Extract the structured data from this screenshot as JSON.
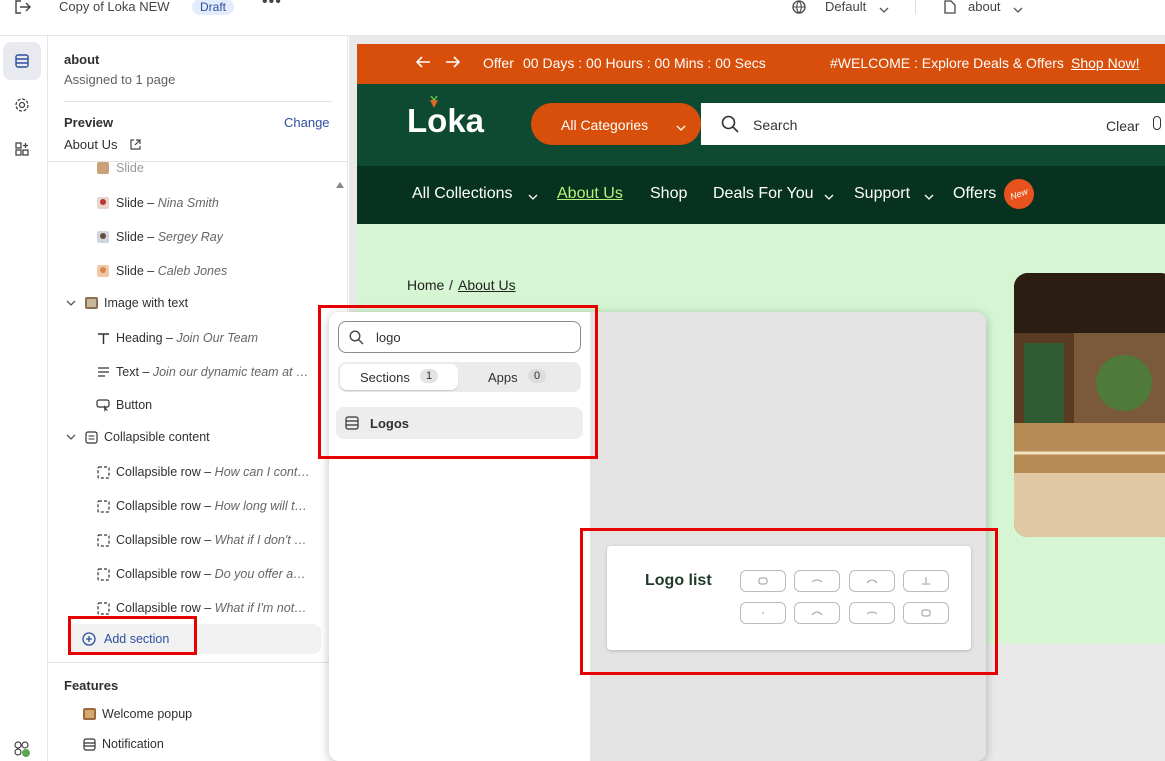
{
  "topbar": {
    "title": "Copy of Loka NEW",
    "status_badge": "Draft",
    "theme_select": "Default",
    "page_select": "about",
    "icons": [
      "exit-icon",
      "more-icon",
      "globe-icon",
      "chevron-down-icon",
      "page-icon"
    ]
  },
  "rail": {
    "icons": [
      "sections-icon",
      "settings-icon",
      "apps-icon",
      "app-store-icon"
    ]
  },
  "panel": {
    "template_name": "about",
    "template_assignment": "Assigned to 1 page",
    "preview_label": "Preview",
    "preview_change": "Change",
    "preview_page": "About Us",
    "tree": [
      {
        "label": "Slide",
        "detail": "Nina Smith",
        "icon": "avatar-icon"
      },
      {
        "label": "Slide",
        "detail": "Sergey Ray",
        "icon": "avatar-icon"
      },
      {
        "label": "Slide",
        "detail": "Caleb Jones",
        "icon": "avatar-icon"
      },
      {
        "label": "Image with text",
        "detail": "",
        "icon": "image-icon"
      },
      {
        "label": "Heading",
        "detail": "Join Our Team",
        "icon": "heading-icon"
      },
      {
        "label": "Text",
        "detail": "Join our dynamic team at …",
        "icon": "text-icon"
      },
      {
        "label": "Button",
        "detail": "",
        "icon": "button-icon"
      },
      {
        "label": "Collapsible content",
        "detail": "",
        "icon": "collapsible-icon"
      },
      {
        "label": "Collapsible row",
        "detail": "How can I cont…",
        "icon": "row-icon"
      },
      {
        "label": "Collapsible row",
        "detail": "How long will t…",
        "icon": "row-icon"
      },
      {
        "label": "Collapsible row",
        "detail": "What if I don't …",
        "icon": "row-icon"
      },
      {
        "label": "Collapsible row",
        "detail": "Do you offer a…",
        "icon": "row-icon"
      },
      {
        "label": "Collapsible row",
        "detail": "What if I'm not…",
        "icon": "row-icon"
      }
    ],
    "add_section": "Add section",
    "features_title": "Features",
    "features": [
      {
        "label": "Welcome popup",
        "icon": "image-icon"
      },
      {
        "label": "Notification",
        "icon": "section-icon"
      }
    ]
  },
  "popover": {
    "search_value": "logo",
    "tabs": [
      {
        "label": "Sections",
        "count": "1"
      },
      {
        "label": "Apps",
        "count": "0"
      }
    ],
    "result": "Logos",
    "preview_title": "Logo list"
  },
  "store": {
    "announce_offer": "Offer",
    "countdown": "00 Days : 00 Hours : 00 Mins : 00 Secs",
    "welcome": "#WELCOME : Explore Deals & Offers",
    "shop_now": "Shop Now!",
    "logo": "Loka",
    "all_categories": "All Categories",
    "search_placeholder": "Search",
    "clear": "Clear",
    "nav": [
      "All Collections",
      "About Us",
      "Shop",
      "Deals For You",
      "Support",
      "Offers"
    ],
    "new_badge": "New",
    "breadcrumb_home": "Home",
    "breadcrumb_sep": "/",
    "breadcrumb_current": "About Us",
    "colors": {
      "announce": "#d74f0a",
      "header": "#0e4a31",
      "nav": "#06321f",
      "hero": "#d5f5d3",
      "highlight": "#e60000"
    }
  }
}
